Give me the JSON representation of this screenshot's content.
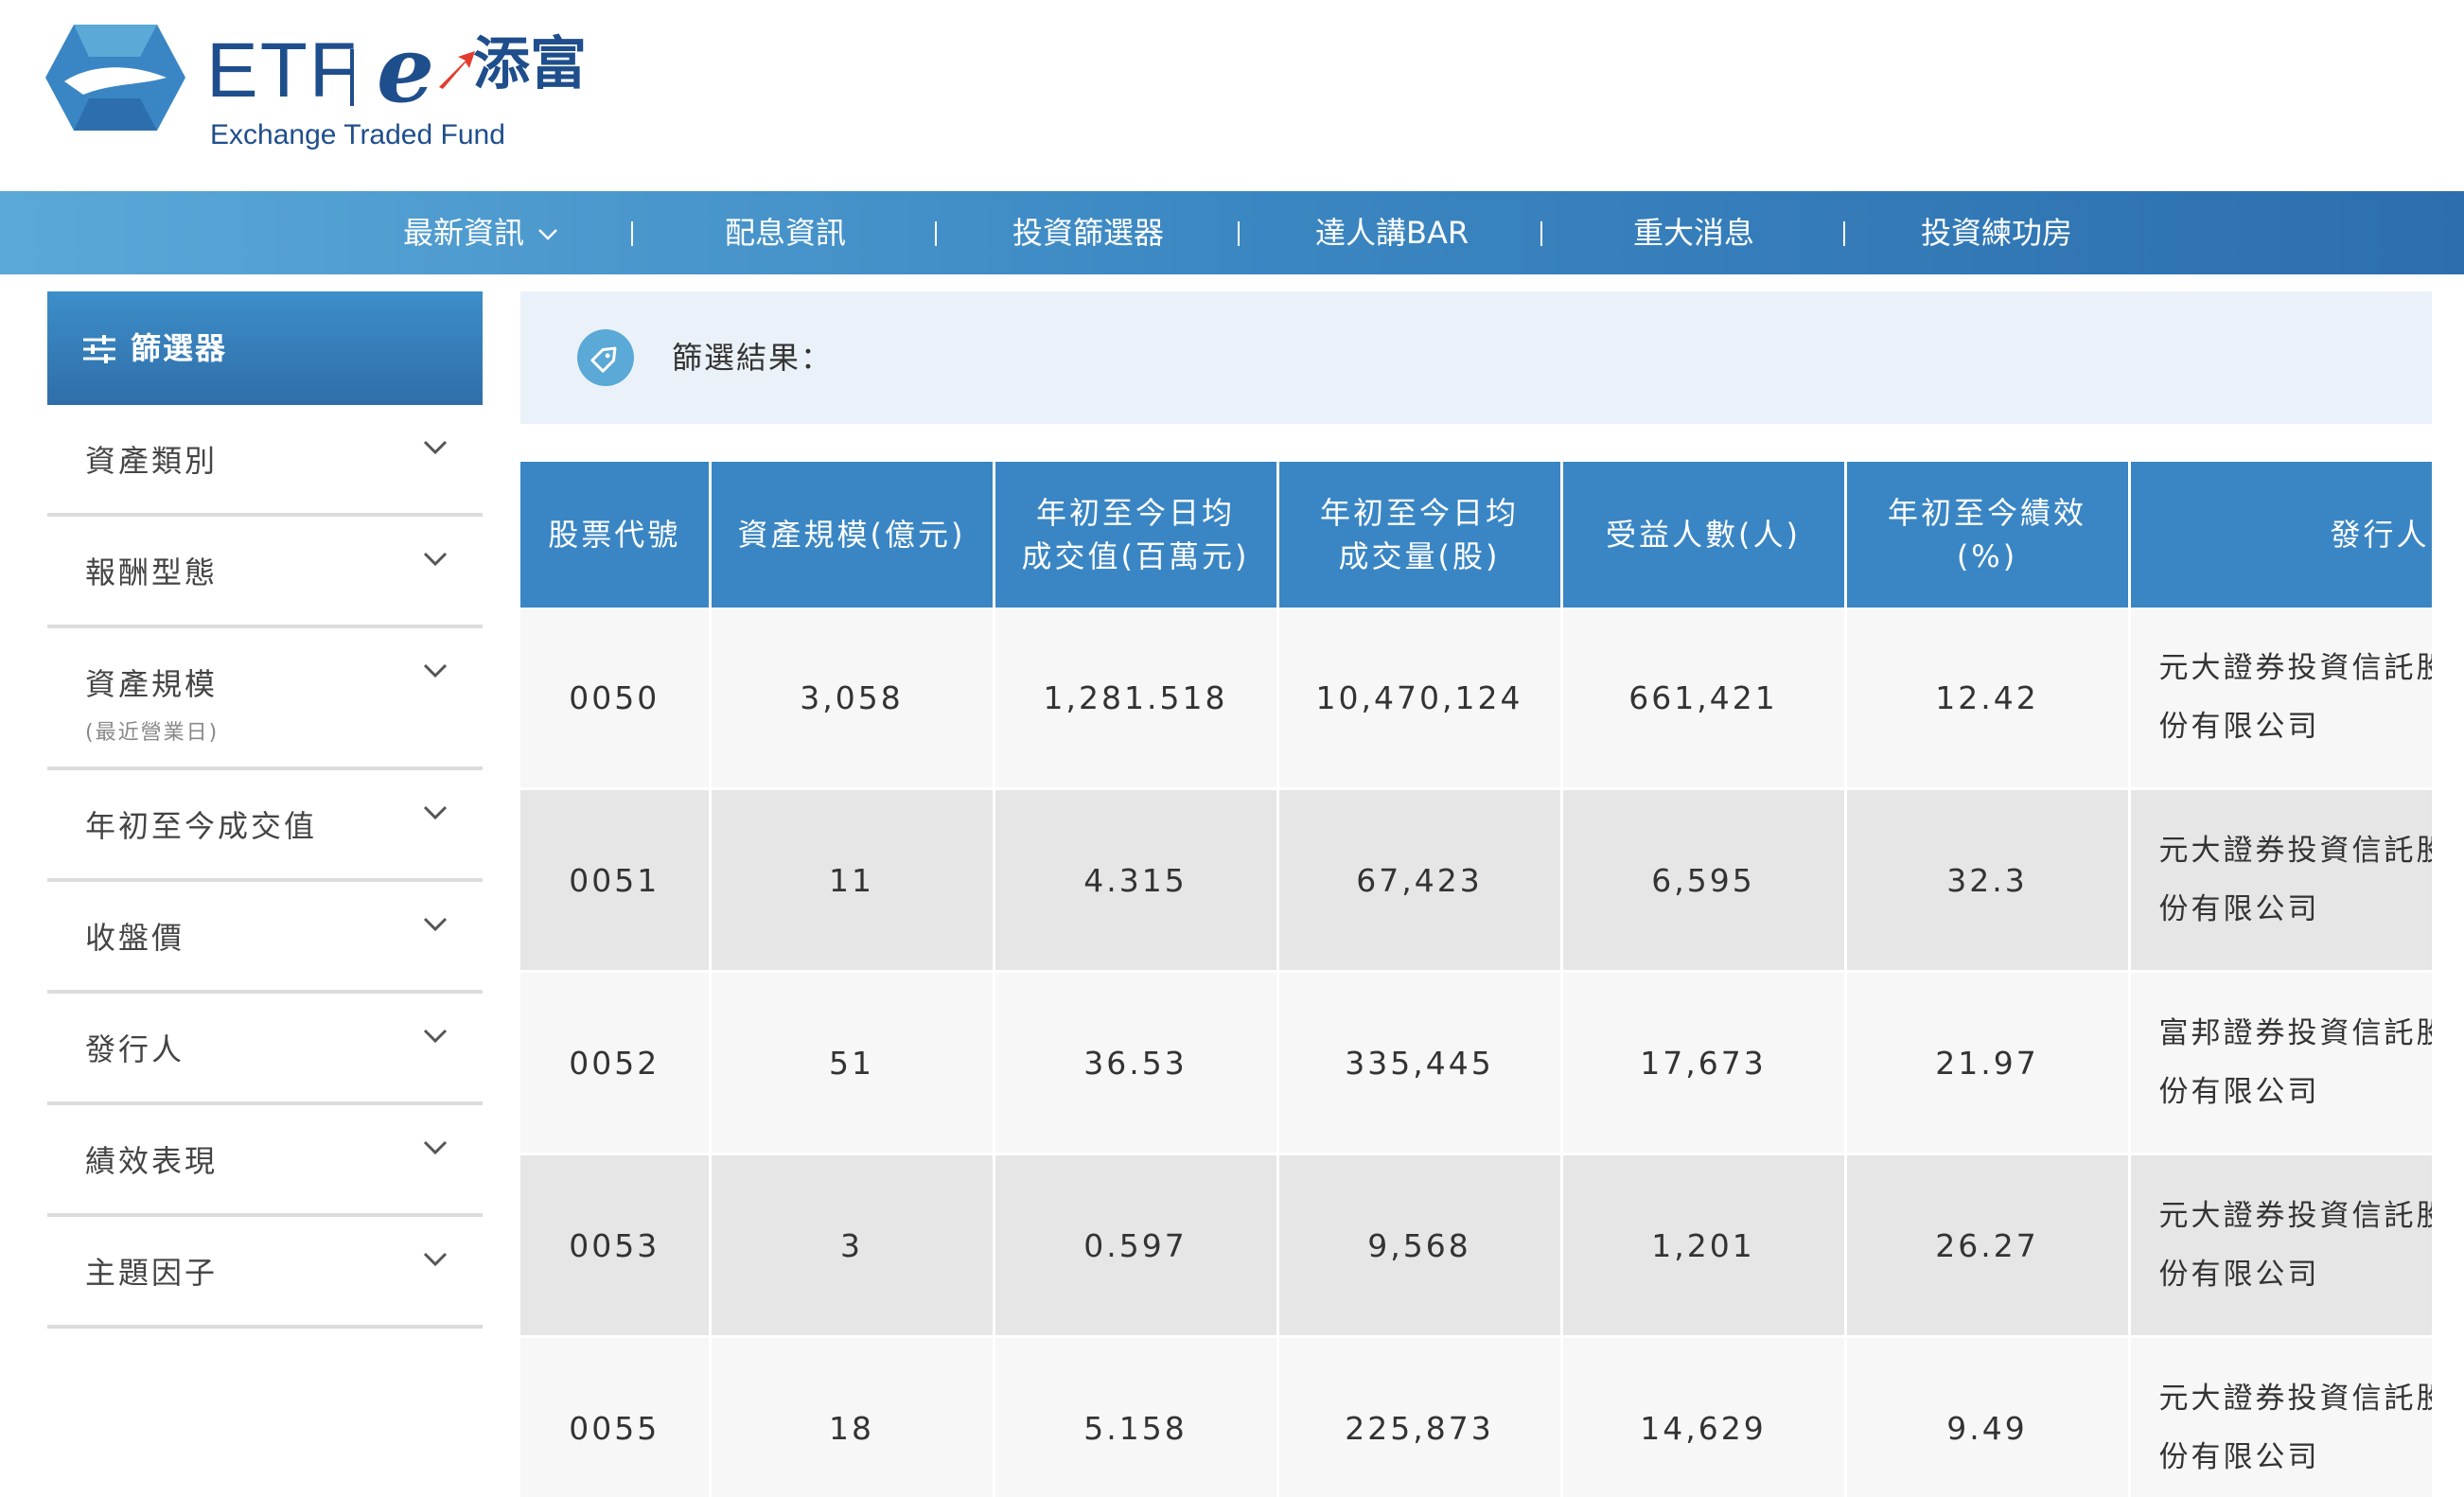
{
  "brand": {
    "etf_text": "ETF",
    "e_letter": "e",
    "cn_name": "添富",
    "subtitle": "Exchange Traded Fund",
    "colors": {
      "brand_blue": "#1f4e8c",
      "nav_blue": "#3b87c2",
      "accent_red": "#e33b2f"
    }
  },
  "nav": {
    "items": [
      {
        "label": "最新資訊",
        "has_dropdown": true
      },
      {
        "label": "配息資訊"
      },
      {
        "label": "投資篩選器"
      },
      {
        "label": "達人講BAR"
      },
      {
        "label": "重大消息"
      },
      {
        "label": "投資練功房"
      }
    ]
  },
  "sidebar": {
    "title": "篩選器",
    "filters": [
      {
        "label": "資產類別"
      },
      {
        "label": "報酬型態"
      },
      {
        "label": "資產規模",
        "sub": "(最近營業日)"
      },
      {
        "label": "年初至今成交值"
      },
      {
        "label": "收盤價"
      },
      {
        "label": "發行人"
      },
      {
        "label": "績效表現"
      },
      {
        "label": "主題因子"
      }
    ]
  },
  "results": {
    "label": "篩選結果："
  },
  "table": {
    "headers": [
      "股票代號",
      "資產規模(億元)",
      "年初至今日均\n成交值(百萬元)",
      "年初至今日均\n成交量(股)",
      "受益人數(人)",
      "年初至今績效\n(%)",
      "發行人"
    ],
    "rows": [
      [
        "0050",
        "3,058",
        "1,281.518",
        "10,470,124",
        "661,421",
        "12.42",
        "元大證券投資信託股",
        "份有限公司"
      ],
      [
        "0051",
        "11",
        "4.315",
        "67,423",
        "6,595",
        "32.3",
        "元大證券投資信託股",
        "份有限公司"
      ],
      [
        "0052",
        "51",
        "36.53",
        "335,445",
        "17,673",
        "21.97",
        "富邦證券投資信託股",
        "份有限公司"
      ],
      [
        "0053",
        "3",
        "0.597",
        "9,568",
        "1,201",
        "26.27",
        "元大證券投資信託股",
        "份有限公司"
      ],
      [
        "0055",
        "18",
        "5.158",
        "225,873",
        "14,629",
        "9.49",
        "元大證券投資信託股",
        "份有限公司"
      ]
    ]
  }
}
